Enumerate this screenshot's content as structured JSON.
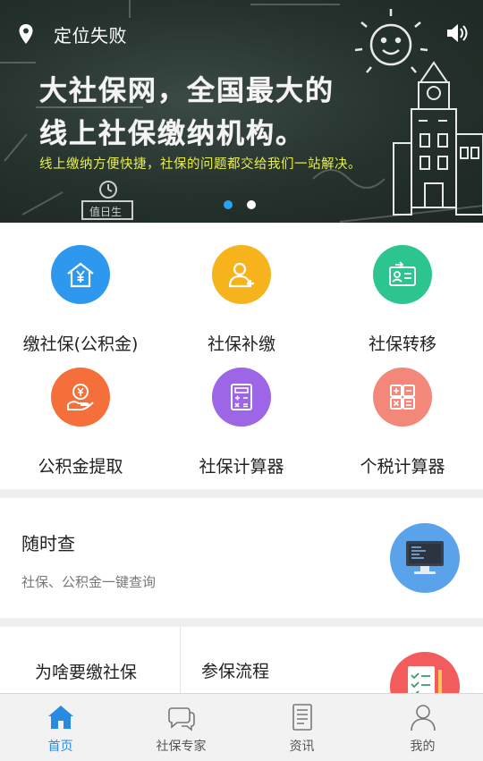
{
  "banner": {
    "location_text": "定位失败",
    "headline_line1": "大社保网，全国最大的",
    "headline_line2": "线上社保缴纳机构。",
    "tagline": "线上缴纳方便快捷，社保的问题都交给我们一站解决。",
    "slides_total": 2,
    "slide_active": 1,
    "chalk_board_text": "值日生"
  },
  "services": [
    {
      "label": "缴社保(公积金)",
      "icon": "house-yuan-icon",
      "color": "#2e98ee"
    },
    {
      "label": "社保补缴",
      "icon": "user-add-icon",
      "color": "#f7b31b"
    },
    {
      "label": "社保转移",
      "icon": "id-card-transfer-icon",
      "color": "#2cc58e"
    },
    {
      "label": "公积金提取",
      "icon": "hand-coin-icon",
      "color": "#f56f3b"
    },
    {
      "label": "社保计算器",
      "icon": "calculator-icon",
      "color": "#9c66e6"
    },
    {
      "label": "个税计算器",
      "icon": "tax-calculator-icon",
      "color": "#f3887a"
    }
  ],
  "query_card": {
    "title": "随时查",
    "subtitle": "社保、公积金一键查询",
    "icon": "monitor-icon",
    "color": "#5aa2ea"
  },
  "bottom_row": {
    "left_title": "为啥要缴社保",
    "right_title": "参保流程",
    "right_icon": "checklist-icon",
    "right_color": "#f25c5c"
  },
  "tabs": [
    {
      "label": "首页",
      "icon": "home-icon",
      "active": true
    },
    {
      "label": "社保专家",
      "icon": "chat-bubbles-icon",
      "active": false
    },
    {
      "label": "资讯",
      "icon": "news-icon",
      "active": false
    },
    {
      "label": "我的",
      "icon": "profile-icon",
      "active": false
    }
  ],
  "colors": {
    "accent": "#2a8ae0",
    "tagline": "#e8ef4a",
    "dot_active": "#2aa2f0"
  }
}
